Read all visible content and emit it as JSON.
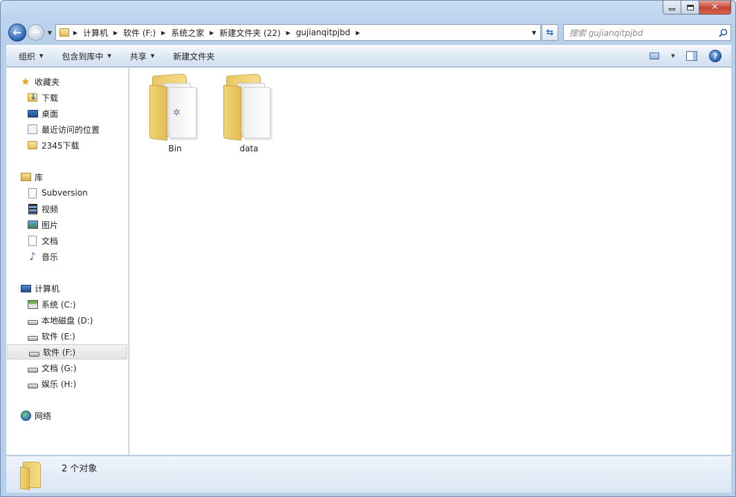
{
  "window": {
    "caption_buttons": {
      "minimize": "minimize-icon",
      "maximize": "maximize-icon",
      "close": "close-icon"
    }
  },
  "addressbar": {
    "crumbs": [
      "计算机",
      "软件 (F:)",
      "系统之家",
      "新建文件夹 (22)",
      "gujianqitpjbd"
    ]
  },
  "search": {
    "placeholder": "搜索 gujianqitpjbd"
  },
  "toolbar": {
    "organize": "组织",
    "include_in_library": "包含到库中",
    "share": "共享",
    "new_folder": "新建文件夹"
  },
  "navpane": {
    "favorites": {
      "label": "收藏夹",
      "items": [
        "下载",
        "桌面",
        "最近访问的位置",
        "2345下载"
      ]
    },
    "libraries": {
      "label": "库",
      "items": [
        "Subversion",
        "视频",
        "图片",
        "文档",
        "音乐"
      ]
    },
    "computer": {
      "label": "计算机",
      "items": [
        "系统 (C:)",
        "本地磁盘 (D:)",
        "软件 (E:)",
        "软件 (F:)",
        "文档 (G:)",
        "娱乐 (H:)"
      ],
      "selected": "软件 (F:)"
    },
    "network": {
      "label": "网络"
    }
  },
  "content": {
    "items": [
      {
        "name": "Bin"
      },
      {
        "name": "data"
      }
    ]
  },
  "statusbar": {
    "text": "2 个对象"
  }
}
